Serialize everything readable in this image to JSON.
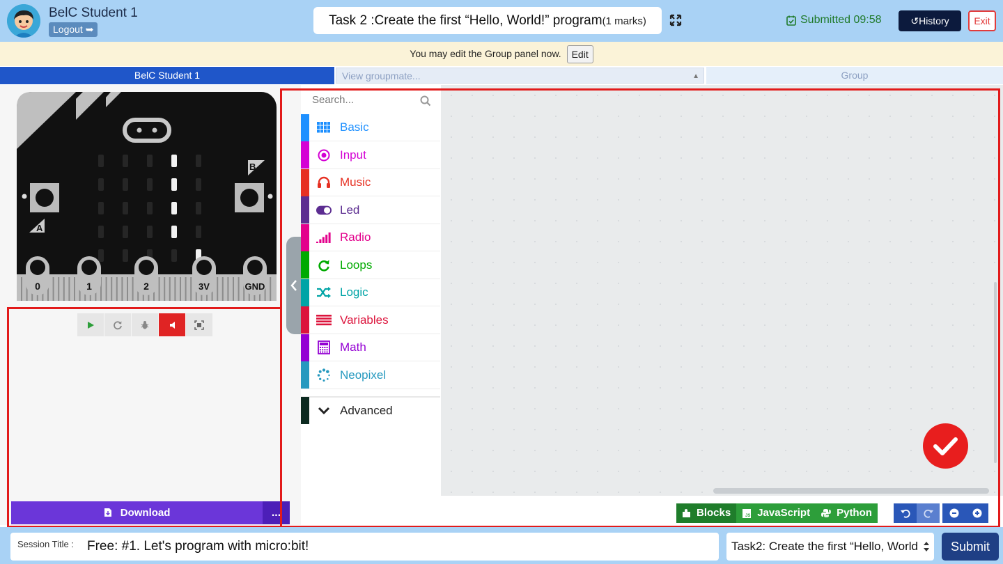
{
  "user": {
    "name": "BelC Student 1",
    "logout_label": "Logout"
  },
  "task": {
    "prefix": "Task 2 :",
    "title": "Create the first “Hello, World!” program",
    "marks": "(1 marks)"
  },
  "status": {
    "submitted": "Submitted 09:58"
  },
  "header_buttons": {
    "history": "History",
    "exit": "Exit"
  },
  "notice": {
    "text": "You may edit the Group panel now.",
    "edit": "Edit"
  },
  "tabs": {
    "student": "BelC Student 1",
    "groupmate_placeholder": "View groupmate...",
    "group": "Group"
  },
  "simulator": {
    "buttons": [
      "A",
      "B"
    ],
    "pins": [
      "0",
      "1",
      "2",
      "3V",
      "GND"
    ],
    "led_matrix": [
      [
        0,
        0,
        0,
        1,
        0
      ],
      [
        0,
        0,
        0,
        1,
        0
      ],
      [
        0,
        0,
        0,
        1,
        0
      ],
      [
        0,
        0,
        0,
        1,
        0
      ],
      [
        0,
        0,
        0,
        0,
        1
      ]
    ],
    "controls": [
      "play-icon",
      "restart-icon",
      "debug-icon",
      "mute-icon",
      "fullscreen-icon"
    ],
    "active_control": "mute-icon"
  },
  "download": {
    "label": "Download",
    "more": "..."
  },
  "toolbox": {
    "search_placeholder": "Search...",
    "categories": [
      {
        "label": "Basic",
        "color": "#1e90ff",
        "icon": "grid-icon"
      },
      {
        "label": "Input",
        "color": "#d400d4",
        "icon": "target-icon"
      },
      {
        "label": "Music",
        "color": "#e63022",
        "icon": "headphones-icon"
      },
      {
        "label": "Led",
        "color": "#5c2d91",
        "icon": "toggle-icon"
      },
      {
        "label": "Radio",
        "color": "#e3008c",
        "icon": "signal-bars-icon"
      },
      {
        "label": "Loops",
        "color": "#00aa00",
        "icon": "refresh-icon"
      },
      {
        "label": "Logic",
        "color": "#00a4a6",
        "icon": "shuffle-icon"
      },
      {
        "label": "Variables",
        "color": "#dc143c",
        "icon": "lines-icon"
      },
      {
        "label": "Math",
        "color": "#9400d3",
        "icon": "calculator-icon"
      },
      {
        "label": "Neopixel",
        "color": "#2699bf",
        "icon": "spinner-icon"
      }
    ],
    "advanced_label": "Advanced"
  },
  "editor_modes": {
    "blocks": "Blocks",
    "javascript": "JavaScript",
    "python": "Python",
    "active": "Blocks"
  },
  "footer": {
    "session_label": "Session Title :",
    "session_value": "Free: #1. Let's program with micro:bit!",
    "task_select": "Task2: Create the first “Hello, World",
    "submit": "Submit"
  }
}
